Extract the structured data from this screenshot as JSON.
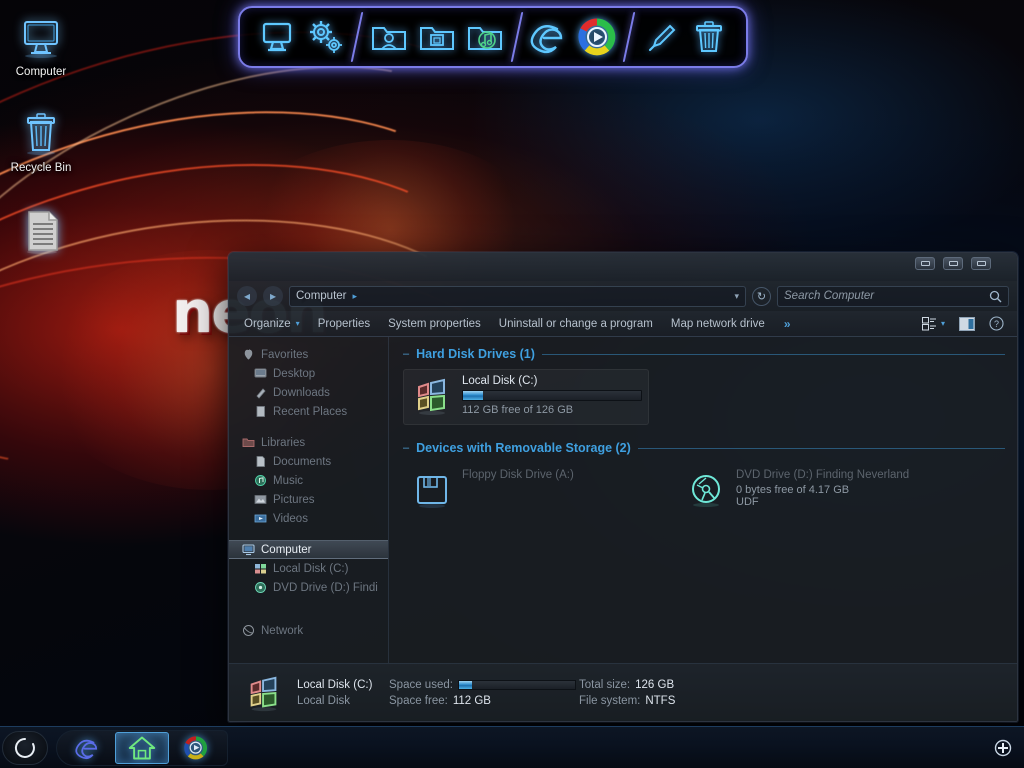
{
  "desktop": {
    "wallpaper_text": "neon",
    "icons": [
      {
        "label": "Computer",
        "icon": "monitor-icon"
      },
      {
        "label": "Recycle Bin",
        "icon": "recycle-bin-icon"
      },
      {
        "label": "",
        "icon": "text-document-icon"
      }
    ]
  },
  "top_dock": {
    "groups": [
      {
        "items": [
          {
            "icon": "monitor-icon",
            "name": "my-computer"
          },
          {
            "icon": "gears-icon",
            "name": "control-panel"
          }
        ]
      },
      {
        "items": [
          {
            "icon": "folder-user-icon",
            "name": "user-folder"
          },
          {
            "icon": "folder-window-icon",
            "name": "documents-folder"
          },
          {
            "icon": "folder-music-icon",
            "name": "music-folder"
          }
        ]
      },
      {
        "items": [
          {
            "icon": "internet-explorer-icon",
            "name": "internet-explorer"
          },
          {
            "icon": "media-player-icon",
            "name": "windows-media-player"
          }
        ]
      },
      {
        "items": [
          {
            "icon": "screwdriver-icon",
            "name": "tools"
          },
          {
            "icon": "trash-icon",
            "name": "recycle-bin"
          }
        ]
      }
    ]
  },
  "explorer": {
    "window_controls": [
      {
        "name": "minimize-button",
        "glyph": "minimize"
      },
      {
        "name": "maximize-button",
        "glyph": "maximize"
      },
      {
        "name": "close-button",
        "glyph": "close"
      }
    ],
    "address": {
      "back_glyph": "◂",
      "forward_glyph": "▸",
      "crumb": "Computer",
      "crumb_sep": "▸",
      "dropdown_caret": "▾",
      "refresh_glyph": "↻"
    },
    "search": {
      "placeholder": "Search Computer",
      "value": "",
      "icon": "search-icon"
    },
    "toolbar": {
      "organize": "Organize",
      "organize_caret": "▾",
      "properties": "Properties",
      "system_properties": "System properties",
      "uninstall": "Uninstall or change a program",
      "map_network_drive": "Map network drive",
      "overflow": "»",
      "views_caret": "▾",
      "preview_pane_icon": "preview-pane-icon",
      "help_icon": "help-icon"
    },
    "navpane": {
      "sections": [
        {
          "header": {
            "label": "Favorites",
            "icon": "favorites-icon"
          },
          "items": [
            {
              "label": "Desktop",
              "icon": "desktop-icon"
            },
            {
              "label": "Downloads",
              "icon": "downloads-icon"
            },
            {
              "label": "Recent Places",
              "icon": "recent-places-icon"
            }
          ]
        },
        {
          "header": {
            "label": "Libraries",
            "icon": "libraries-icon"
          },
          "items": [
            {
              "label": "Documents",
              "icon": "documents-icon"
            },
            {
              "label": "Music",
              "icon": "music-icon"
            },
            {
              "label": "Pictures",
              "icon": "pictures-icon"
            },
            {
              "label": "Videos",
              "icon": "videos-icon"
            }
          ]
        },
        {
          "header": {
            "label": "Computer",
            "icon": "computer-icon",
            "selected": true
          },
          "items": [
            {
              "label": "Local Disk (C:)",
              "icon": "hard-disk-icon"
            },
            {
              "label": "DVD Drive (D:) Findi",
              "icon": "dvd-icon"
            }
          ]
        },
        {
          "header": {
            "label": "Network",
            "icon": "network-icon"
          },
          "items": []
        }
      ]
    },
    "content": {
      "groups": [
        {
          "title": "Hard Disk Drives (1)",
          "collapse_glyph": "–",
          "drives": [
            {
              "name": "Local Disk (C:)",
              "sub": "112 GB free of 126 GB",
              "icon": "windows-disk-icon",
              "has_bar": true,
              "used_percent": 11,
              "dim": false
            }
          ]
        },
        {
          "title": "Devices with Removable Storage (2)",
          "collapse_glyph": "–",
          "drives": [
            {
              "name": "Floppy Disk Drive (A:)",
              "sub": "",
              "icon": "floppy-icon",
              "has_bar": false,
              "used_percent": 0,
              "dim": true
            },
            {
              "name": "DVD Drive (D:) Finding Neverland",
              "sub": "0 bytes free of 4.17 GB",
              "sub2": "UDF",
              "icon": "dvd-disc-icon",
              "has_bar": false,
              "used_percent": 0,
              "dim": true
            }
          ]
        }
      ]
    },
    "details": {
      "icon": "windows-disk-icon",
      "title": "Local Disk (C:)",
      "subtitle": "Local Disk",
      "space_used_label": "Space used:",
      "space_used_percent": 11,
      "space_free_label": "Space free:",
      "space_free_value": "112 GB",
      "total_size_label": "Total size:",
      "total_size_value": "126 GB",
      "file_system_label": "File system:",
      "file_system_value": "NTFS"
    }
  },
  "taskbar": {
    "start": {
      "name": "start-orb",
      "icon": "start-orb-icon"
    },
    "apps": [
      {
        "name": "taskbar-internet-explorer",
        "icon": "internet-explorer-icon",
        "active": false
      },
      {
        "name": "taskbar-explorer-window",
        "icon": "home-icon",
        "active": true
      },
      {
        "name": "taskbar-media-player",
        "icon": "media-player-icon",
        "active": false
      }
    ],
    "tray": [
      {
        "name": "show-hidden-icons",
        "icon": "plus-circle-icon"
      }
    ]
  },
  "colors": {
    "accent_blue": "#3fa0e0",
    "neon_violet": "#7b7ce8",
    "neon_cyan": "#5ec8ff",
    "taskbar_bg": "#0a1220",
    "window_bg": "#1a1e23"
  }
}
